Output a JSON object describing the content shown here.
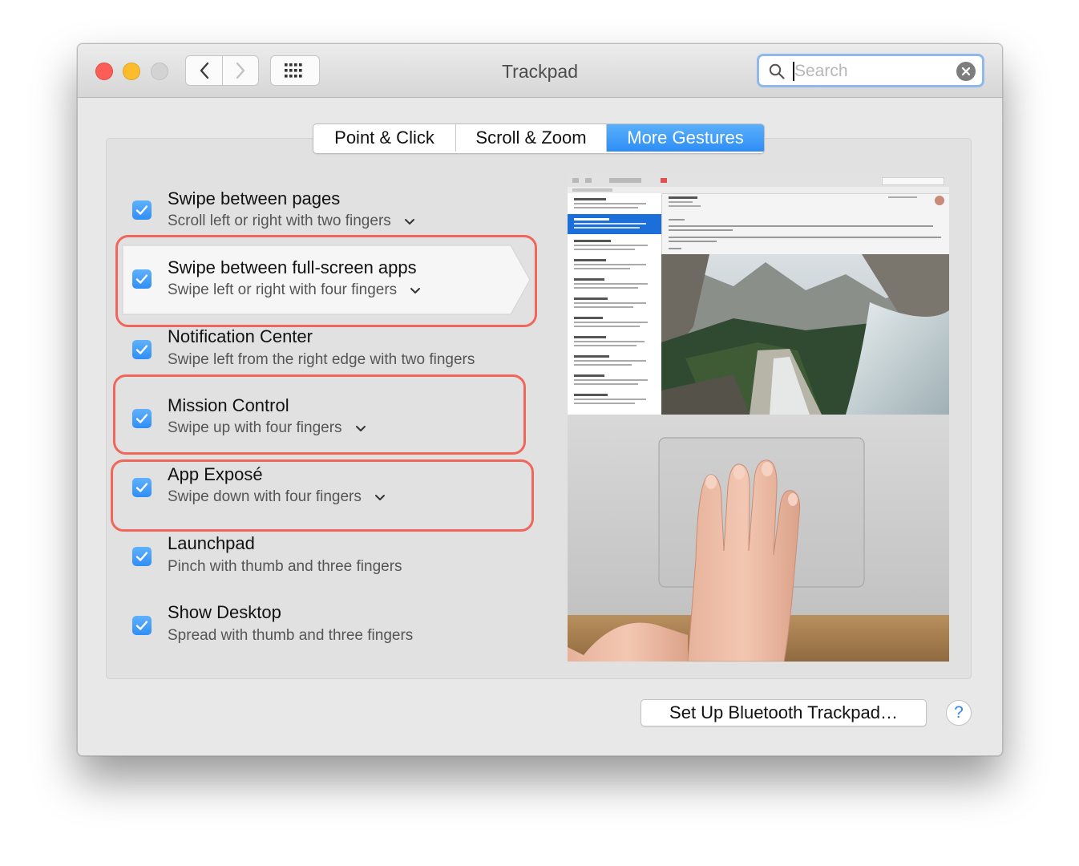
{
  "window": {
    "title": "Trackpad"
  },
  "search": {
    "placeholder": "Search",
    "value": ""
  },
  "tabs": [
    {
      "label": "Point & Click",
      "selected": false
    },
    {
      "label": "Scroll & Zoom",
      "selected": false
    },
    {
      "label": "More Gestures",
      "selected": true
    }
  ],
  "gestures": [
    {
      "title": "Swipe between pages",
      "subtitle": "Scroll left or right with two fingers",
      "checked": true,
      "has_options": true
    },
    {
      "title": "Swipe between full-screen apps",
      "subtitle": "Swipe left or right with four fingers",
      "checked": true,
      "has_options": true,
      "selected": true,
      "highlighted": true
    },
    {
      "title": "Notification Center",
      "subtitle": "Swipe left from the right edge with two fingers",
      "checked": true,
      "has_options": false
    },
    {
      "title": "Mission Control",
      "subtitle": "Swipe up with four fingers",
      "checked": true,
      "has_options": true,
      "highlighted": true
    },
    {
      "title": "App Exposé",
      "subtitle": "Swipe down with four fingers",
      "checked": true,
      "has_options": true,
      "highlighted": true
    },
    {
      "title": "Launchpad",
      "subtitle": "Pinch with thumb and three fingers",
      "checked": true,
      "has_options": false
    },
    {
      "title": "Show Desktop",
      "subtitle": "Spread with thumb and three fingers",
      "checked": true,
      "has_options": false
    }
  ],
  "buttons": {
    "setup": "Set Up Bluetooth Trackpad…",
    "help": "?"
  },
  "colors": {
    "accent": "#2f8ef6",
    "highlight_ring": "#f0665b"
  },
  "icons": [
    "back-chevron-icon",
    "forward-chevron-icon",
    "grid-icon",
    "search-icon",
    "clear-icon",
    "checkmark-icon",
    "chevron-down-icon",
    "help-icon"
  ]
}
